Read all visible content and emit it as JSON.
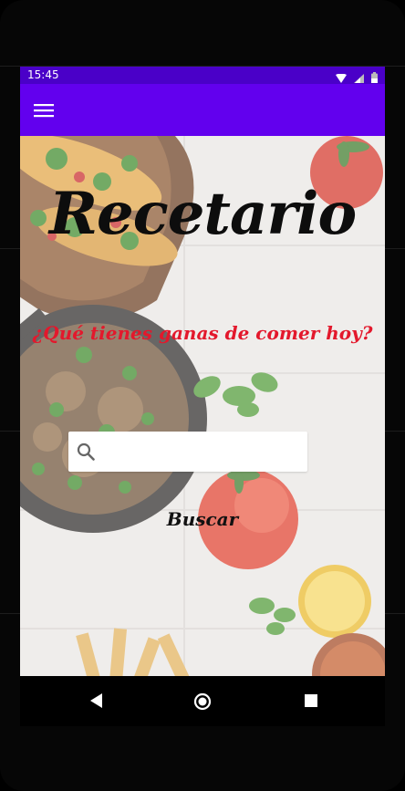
{
  "status_bar": {
    "time": "15:45",
    "icons": [
      "wifi-icon",
      "signal-icon",
      "battery-icon"
    ],
    "bg_color": "#4a00c8"
  },
  "app_bar": {
    "menu_icon": "hamburger-menu-icon",
    "bg_color": "#6200ee"
  },
  "main": {
    "title": "Recetario",
    "subtitle": "¿Qué tienes ganas de comer hoy?",
    "search": {
      "value": "",
      "placeholder": "",
      "icon": "search-icon"
    },
    "search_button_label": "Buscar",
    "colors": {
      "title": "#0d0d0d",
      "subtitle": "#e3182c"
    }
  },
  "nav_bar": {
    "buttons": [
      "back-icon",
      "home-icon",
      "recents-icon"
    ]
  }
}
